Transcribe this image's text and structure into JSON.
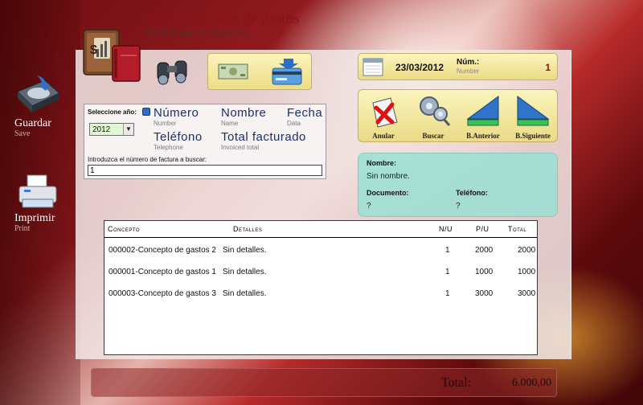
{
  "header": {
    "title": "Buscar apuntes de gastos",
    "subtitle": "Find notes of expenses"
  },
  "sidebar": {
    "save_label": "Guardar",
    "save_sub": "Save",
    "print_label": "Imprimir",
    "print_sub": "Print"
  },
  "date_box": {
    "date": "23/03/2012",
    "number_label": "Núm.:",
    "number_sub": "Number",
    "number_value": "1"
  },
  "nav": {
    "cancel": "Anular",
    "search": "Buscar",
    "previous": "B.Anterior",
    "next": "B.Siguiente"
  },
  "search": {
    "year_label": "Seleccione año:",
    "year_value": "2012",
    "field_number": "Número",
    "field_number_sub": "Number",
    "field_name": "Nombre",
    "field_name_sub": "Name",
    "field_date": "Fecha",
    "field_date_sub": "Data",
    "field_phone": "Teléfono",
    "field_phone_sub": "Telephone",
    "field_total": "Total facturado",
    "field_total_sub": "Invoiced total",
    "prompt": "Introduzca el número de factura a buscar:",
    "input_value": "1"
  },
  "info": {
    "name_label": "Nombre:",
    "name_value": "Sin nombre.",
    "doc_label": "Documento:",
    "doc_value": "?",
    "phone_label": "Teléfono:",
    "phone_value": "?"
  },
  "table": {
    "columns": [
      "Concepto",
      "Detalles",
      "N/U",
      "P/U",
      "Total"
    ],
    "rows": [
      {
        "concepto": "000002-Concepto de gastos 2",
        "detalles": "Sin detalles.",
        "nu": "1",
        "pu": "2000",
        "total": "2000"
      },
      {
        "concepto": "000001-Concepto de gastos 1",
        "detalles": "Sin detalles.",
        "nu": "1",
        "pu": "1000",
        "total": "1000"
      },
      {
        "concepto": "000003-Concepto de gastos 3",
        "detalles": "Sin detalles.",
        "nu": "1",
        "pu": "3000",
        "total": "3000"
      }
    ]
  },
  "footer": {
    "total_label": "Total:",
    "total_value": "6.000,00"
  }
}
